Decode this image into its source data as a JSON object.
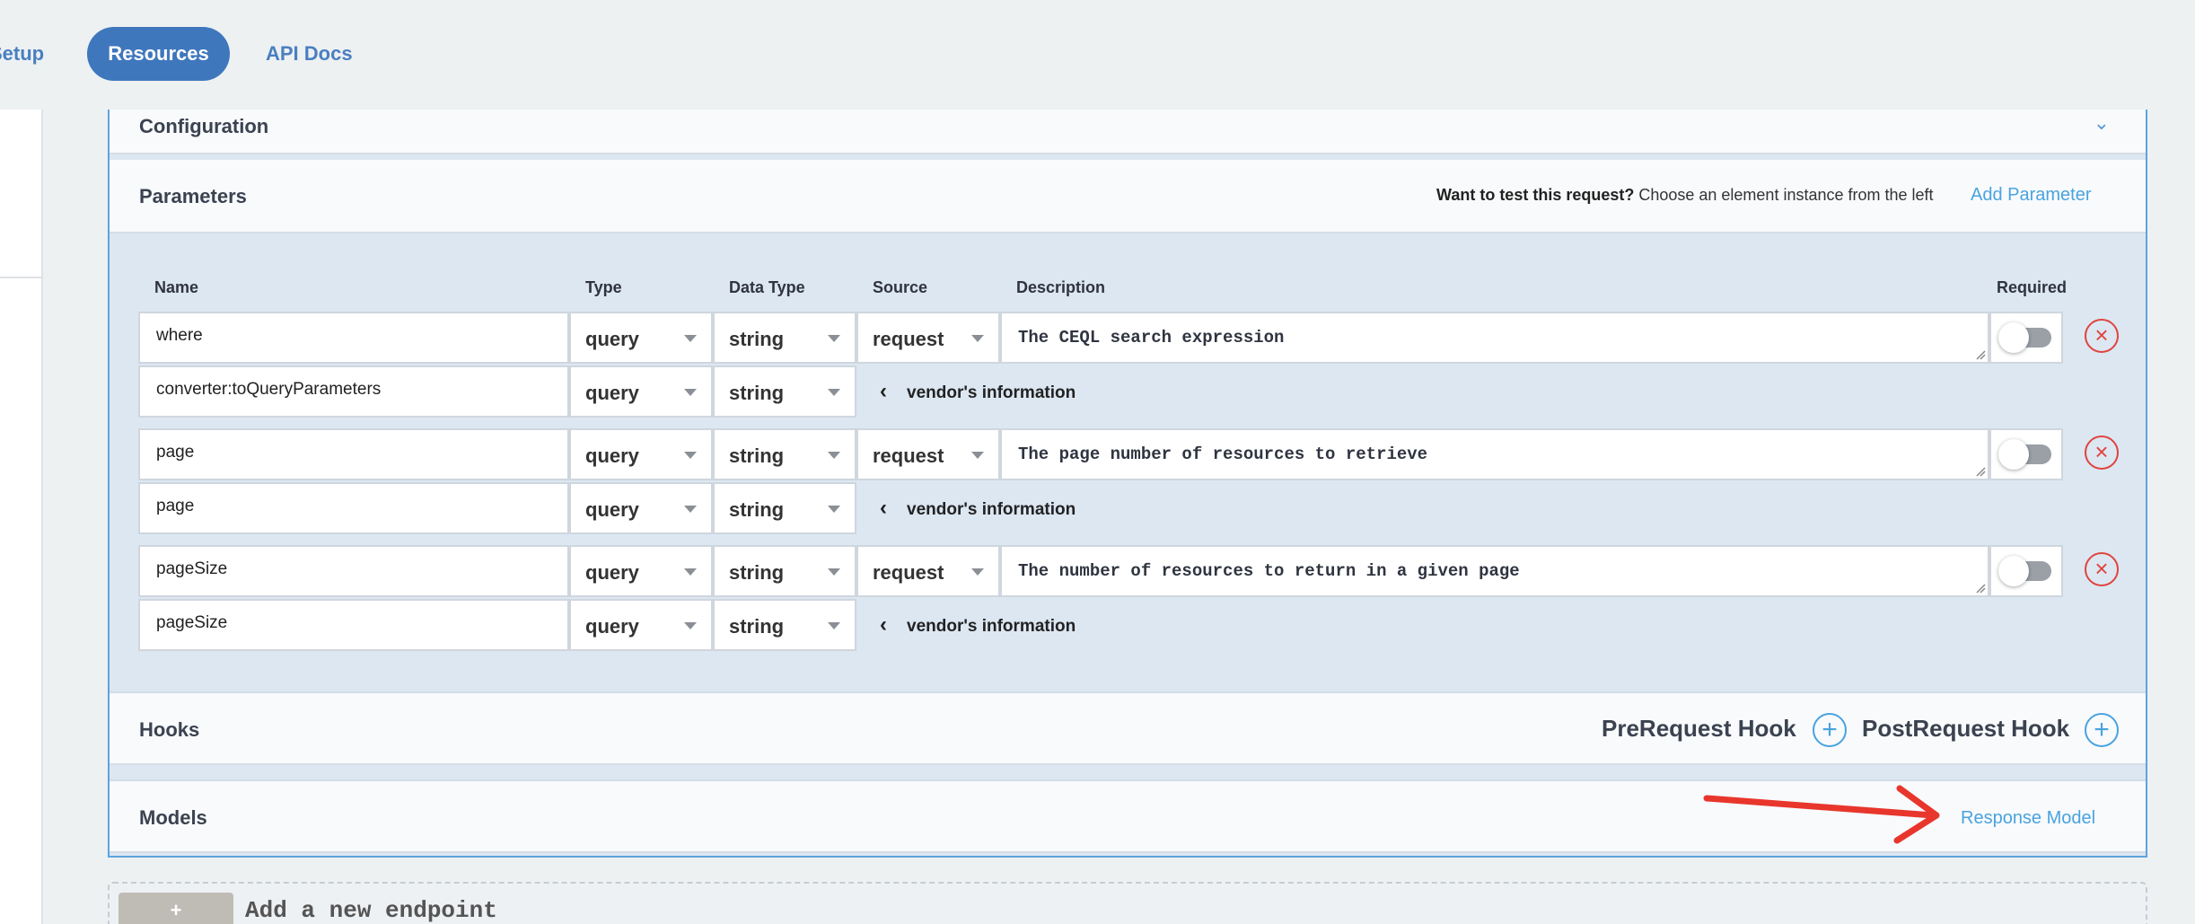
{
  "nav": {
    "setup": "Setup",
    "resources": "Resources",
    "api_docs": "API Docs"
  },
  "configuration": {
    "title": "Configuration"
  },
  "parameters": {
    "title": "Parameters",
    "test_hint_bold": "Want to test this request?",
    "test_hint_rest": " Choose an element instance from the left",
    "add_parameter": "Add Parameter",
    "columns": {
      "name": "Name",
      "type": "Type",
      "data_type": "Data Type",
      "source": "Source",
      "description": "Description",
      "required": "Required"
    },
    "rows": [
      {
        "name": "where",
        "type": "query",
        "data_type": "string",
        "source": "request",
        "description": "The CEQL search expression",
        "required": false,
        "vendor_name": "converter:toQueryParameters",
        "vendor_type": "query",
        "vendor_data_type": "string",
        "vendor_label": "vendor's information"
      },
      {
        "name": "page",
        "type": "query",
        "data_type": "string",
        "source": "request",
        "description": "The page number of resources to retrieve",
        "required": false,
        "vendor_name": "page",
        "vendor_type": "query",
        "vendor_data_type": "string",
        "vendor_label": "vendor's information"
      },
      {
        "name": "pageSize",
        "type": "query",
        "data_type": "string",
        "source": "request",
        "description": "The number of resources to return in a given page",
        "required": false,
        "vendor_name": "pageSize",
        "vendor_type": "query",
        "vendor_data_type": "string",
        "vendor_label": "vendor's information"
      }
    ]
  },
  "hooks": {
    "title": "Hooks",
    "pre_request": "PreRequest Hook",
    "post_request": "PostRequest Hook"
  },
  "models": {
    "title": "Models",
    "response_model": "Response Model"
  },
  "add_endpoint": {
    "button": "+",
    "label": "Add a new endpoint"
  },
  "colors": {
    "accent": "#3f77bd",
    "link": "#4aa3df",
    "danger": "#e0443e",
    "annotation_arrow": "#e8362c"
  }
}
